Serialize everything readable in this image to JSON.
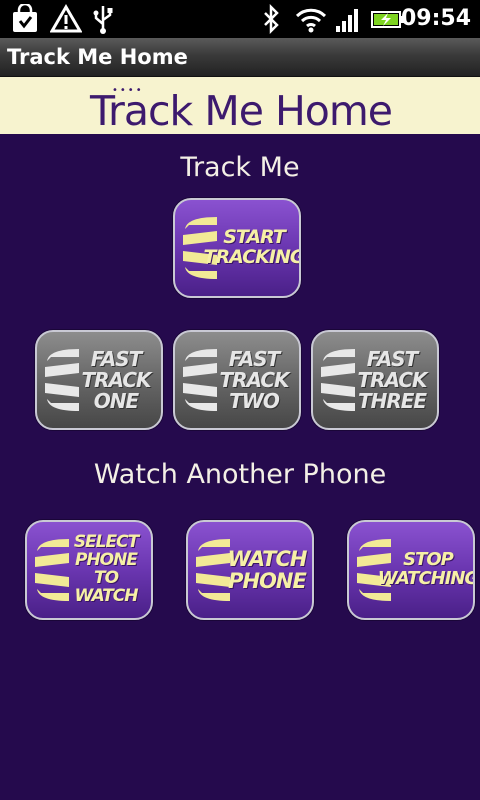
{
  "status_bar": {
    "time": "09:54",
    "icons": [
      "shopping-bag-icon",
      "warning-icon",
      "usb-icon",
      "bluetooth-icon",
      "wifi-icon",
      "signal-icon",
      "battery-charging-icon"
    ]
  },
  "title_bar": {
    "title": "Track Me Home"
  },
  "banner": {
    "logo_text": "Track Me Home"
  },
  "track_me": {
    "heading": "Track Me",
    "start_button": "START\nTRACKING",
    "fast_buttons": [
      "FAST\nTRACK\nONE",
      "FAST\nTRACK\nTWO",
      "FAST\nTRACK\nTHREE"
    ]
  },
  "watch": {
    "heading": "Watch Another Phone",
    "buttons": [
      "SELECT\nPHONE\nTO\nWATCH",
      "WATCH\nPHONE",
      "STOP\nWATCHING"
    ]
  },
  "colors": {
    "background": "#250a4d",
    "banner": "#f7f3cf",
    "logo": "#3d1a6e",
    "button_purple": "#6a36b0",
    "button_grey": "#676767",
    "button_label_purple": "#f6f0a6"
  }
}
